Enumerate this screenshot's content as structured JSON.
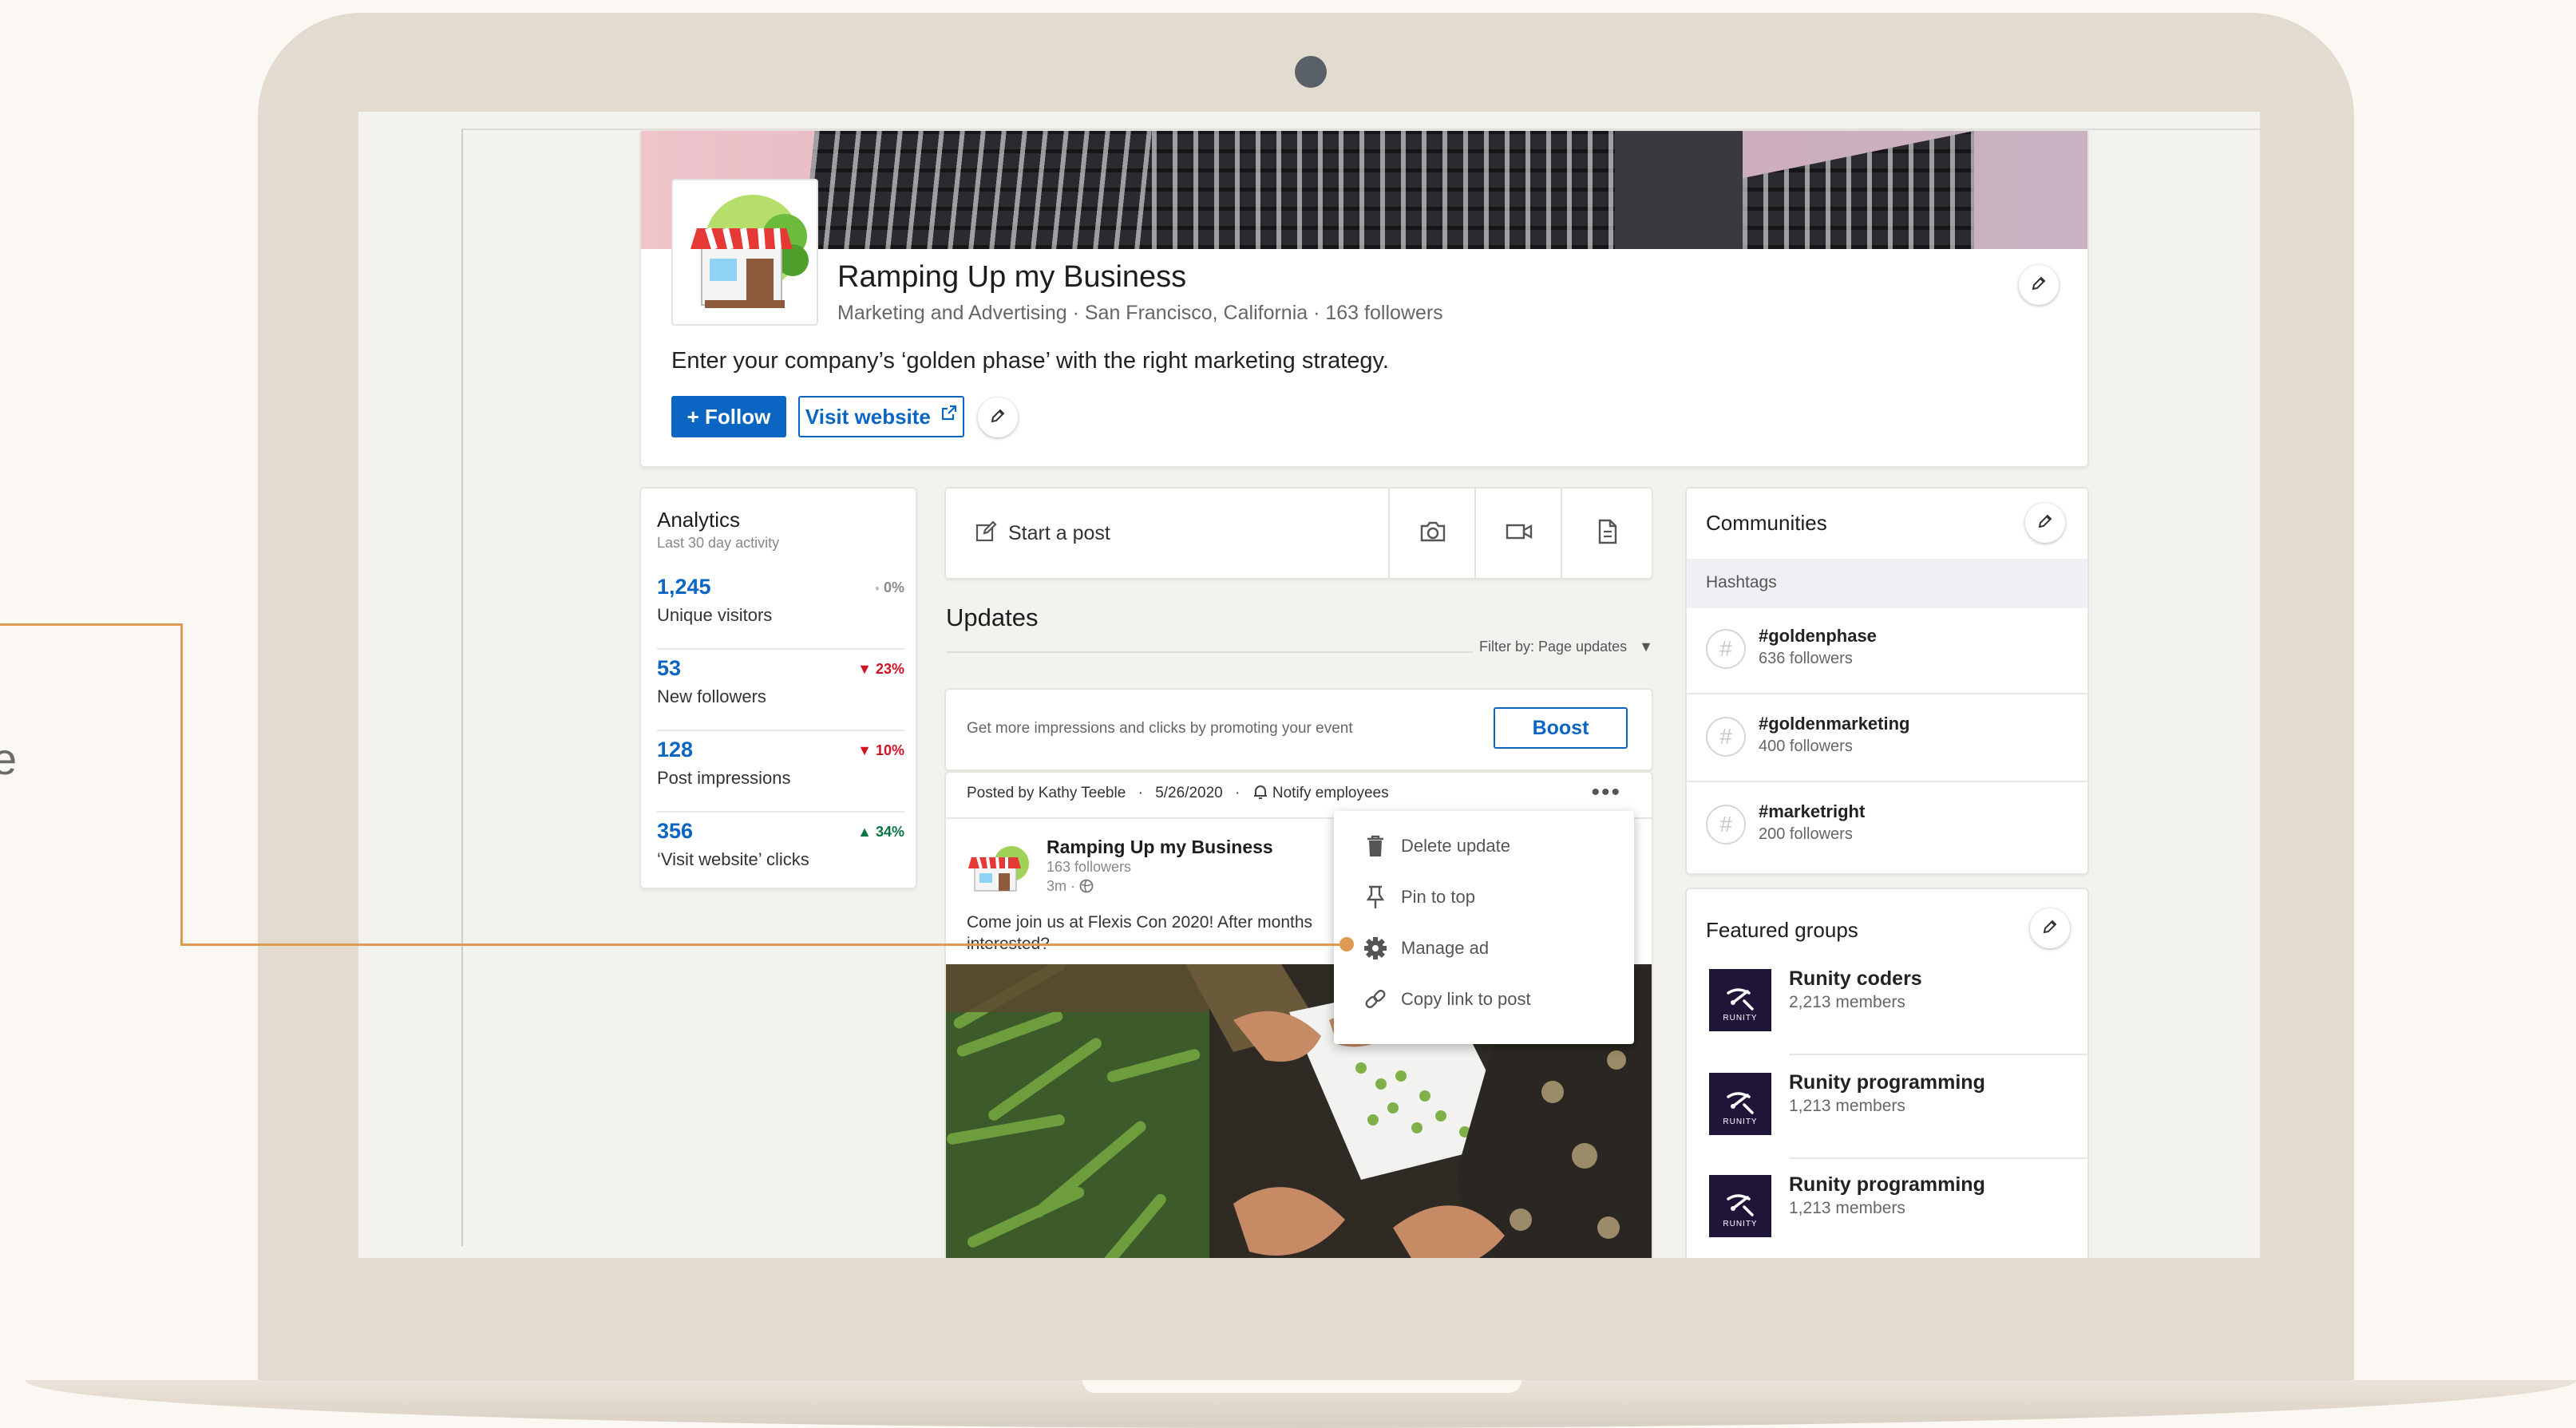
{
  "company": {
    "name": "Ramping Up my Business",
    "meta": "Marketing and Advertising · San Francisco, California · 163 followers",
    "tagline": "Enter your company’s ‘golden phase’ with the right marketing strategy.",
    "follow_label": "+ Follow",
    "visit_label": "Visit website"
  },
  "analytics": {
    "title": "Analytics",
    "subtitle": "Last 30 day activity",
    "rows": [
      {
        "value": "1,245",
        "label": "Unique visitors",
        "change": "0%",
        "trend": "none",
        "color": "#8a8a8a"
      },
      {
        "value": "53",
        "label": "New followers",
        "change": "23%",
        "trend": "down",
        "color": "#d11124"
      },
      {
        "value": "128",
        "label": "Post impressions",
        "change": "10%",
        "trend": "down",
        "color": "#d11124"
      },
      {
        "value": "356",
        "label": "‘Visit website’ clicks",
        "change": "34%",
        "trend": "up",
        "color": "#057642"
      }
    ]
  },
  "composer": {
    "start_label": "Start a post",
    "icons": [
      "camera-icon",
      "video-icon",
      "document-icon"
    ]
  },
  "updates": {
    "title": "Updates",
    "filter_label": "Filter by: Page updates"
  },
  "boost": {
    "text": "Get more impressions and clicks by promoting your event",
    "button_label": "Boost"
  },
  "post": {
    "posted_by": "Posted by Kathy Teeble",
    "date": "5/26/2020",
    "notify": "Notify employees",
    "author": "Ramping Up my Business",
    "followers": "163 followers",
    "time": "3m ·",
    "text_line1": "Come join us at Flexis Con 2020! After months",
    "text_line2": "interested?"
  },
  "menu": {
    "items": [
      {
        "label": "Delete update",
        "icon": "trash-icon"
      },
      {
        "label": "Pin to top",
        "icon": "pin-icon"
      },
      {
        "label": "Manage ad",
        "icon": "gear-icon"
      },
      {
        "label": "Copy link to post",
        "icon": "link-icon"
      }
    ]
  },
  "communities": {
    "title": "Communities",
    "hashtags_label": "Hashtags",
    "tags": [
      {
        "name": "#goldenphase",
        "followers": "636 followers"
      },
      {
        "name": "#goldenmarketing",
        "followers": "400 followers"
      },
      {
        "name": "#marketright",
        "followers": "200 followers"
      }
    ]
  },
  "groups": {
    "title": "Featured groups",
    "logo_text": "RUNITY",
    "items": [
      {
        "name": "Runity coders",
        "members": "2,213 members"
      },
      {
        "name": "Runity programming",
        "members": "1,213 members"
      },
      {
        "name": "Runity programming",
        "members": "1,213 members"
      }
    ]
  },
  "colors": {
    "accent": "#0a66c2",
    "callout": "#dc9a52",
    "laptop": "#e3dbd0",
    "background": "#fbf8f3"
  },
  "edge_text": "e"
}
